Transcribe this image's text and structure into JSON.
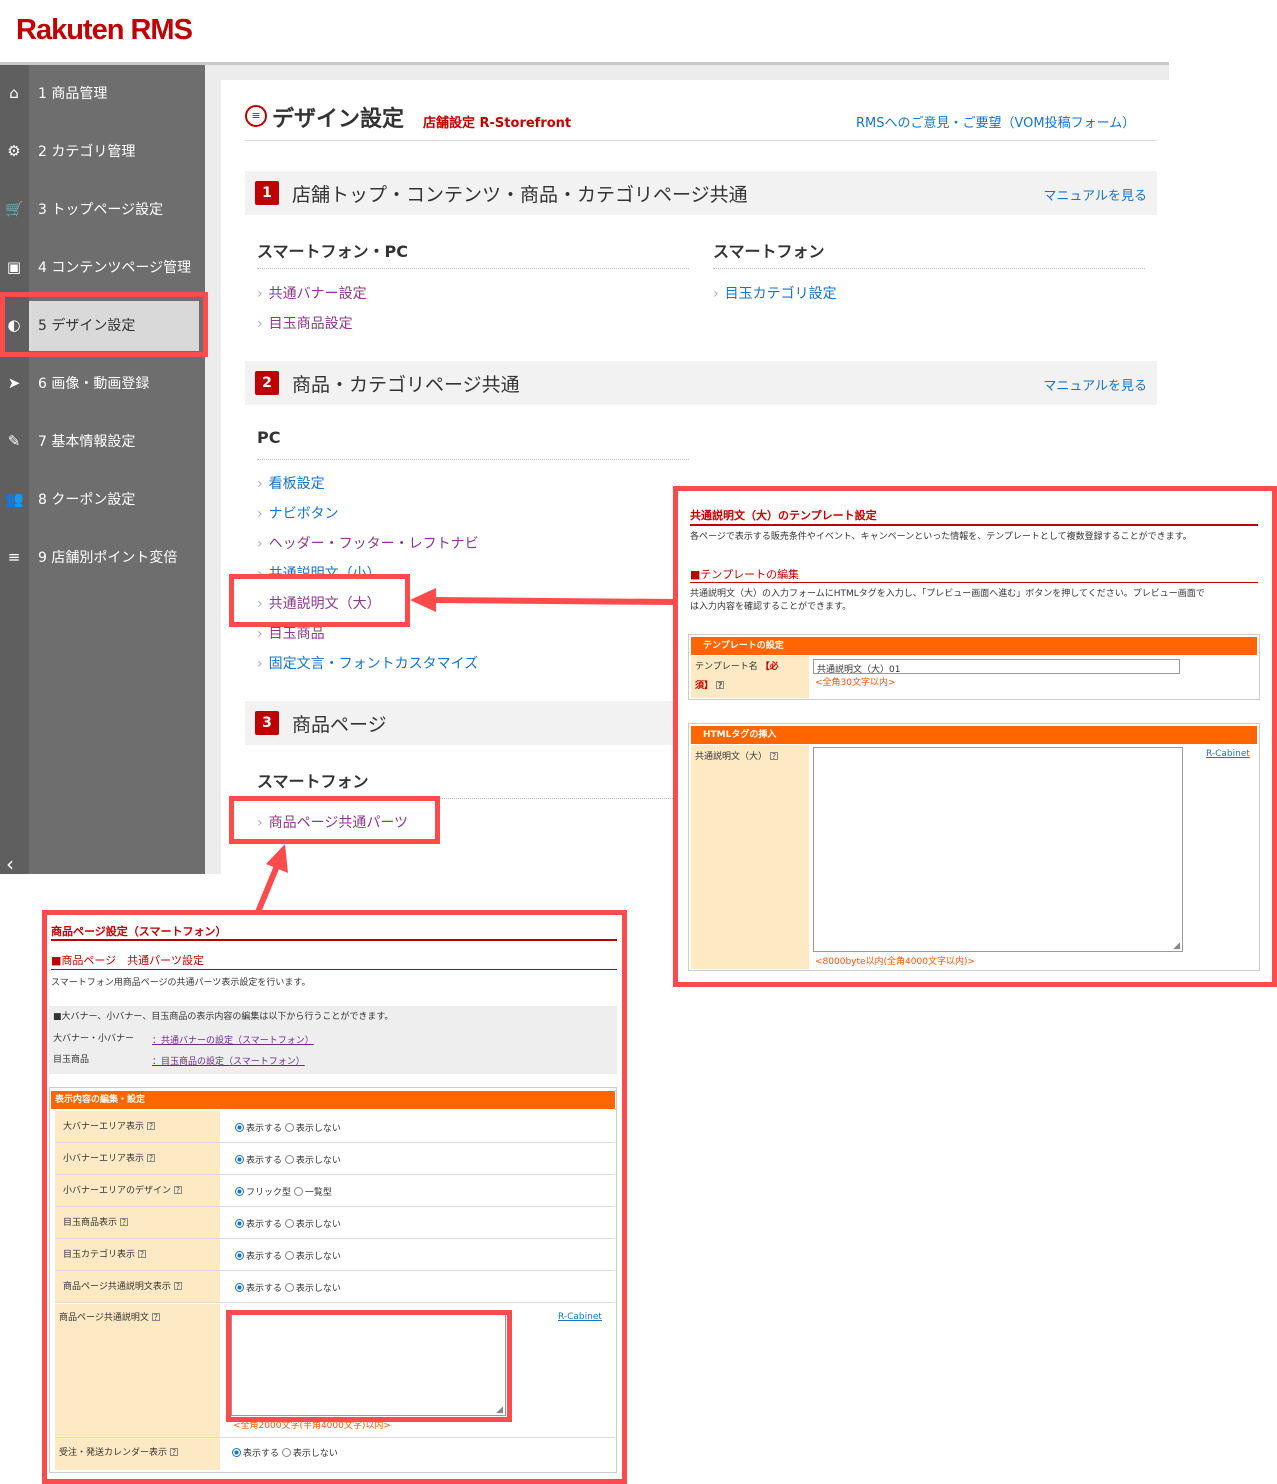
{
  "app": {
    "logo": "Rakuten RMS"
  },
  "sidebar": {
    "items": [
      {
        "label": "1 商品管理",
        "icon": "home-icon",
        "glyph": "⌂"
      },
      {
        "label": "2 カテゴリ管理",
        "icon": "gear-icon",
        "glyph": "⚙"
      },
      {
        "label": "3 トップページ設定",
        "icon": "cart-icon",
        "glyph": "🛒"
      },
      {
        "label": "4 コンテンツページ管理",
        "icon": "pages-icon",
        "glyph": "▣"
      },
      {
        "label": "5 デザイン設定",
        "icon": "paint-icon",
        "glyph": "◐"
      },
      {
        "label": "6 画像・動画登録",
        "icon": "send-icon",
        "glyph": "➤"
      },
      {
        "label": "7 基本情報設定",
        "icon": "megaphone-icon",
        "glyph": "✎"
      },
      {
        "label": "8 クーポン設定",
        "icon": "users-icon",
        "glyph": "👥"
      },
      {
        "label": "9 店舗別ポイント変倍",
        "icon": "list-icon",
        "glyph": "≡"
      }
    ],
    "collapse": "‹"
  },
  "header": {
    "title": "デザイン設定",
    "subtitle": "店舗設定 R-Storefront",
    "feedback": "RMSへのご意見・ご要望（VOM投稿フォーム）",
    "title_icon": "list-icon"
  },
  "sections": [
    {
      "num": "1",
      "title": "店舗トップ・コンテンツ・商品・カテゴリページ共通",
      "manual": "マニュアルを見る"
    },
    {
      "num": "2",
      "title": "商品・カテゴリページ共通",
      "manual": "マニュアルを見る"
    },
    {
      "num": "3",
      "title": "商品ページ"
    }
  ],
  "s1": {
    "col1": "スマートフォン・PC",
    "col2": "スマートフォン",
    "links1": [
      "共通バナー設定",
      "目玉商品設定"
    ],
    "links2": [
      "目玉カテゴリ設定"
    ]
  },
  "s2": {
    "col1": "PC",
    "links": [
      "看板設定",
      "ナビボタン",
      "ヘッダー・フッター・レフトナビ",
      "共通説明文（小）",
      "共通説明文（大）",
      "目玉商品",
      "固定文言・フォントカスタマイズ"
    ]
  },
  "s3": {
    "col1": "スマートフォン",
    "links": [
      "商品ページ共通パーツ"
    ]
  },
  "panel_right": {
    "title": "共通説明文（大）のテンプレート設定",
    "desc": "各ページで表示する販売条件やイベント、キャンペーンといった情報を、テンプレートとして複数登録することができます。",
    "edit_title": "■テンプレートの編集",
    "edit_desc1": "共通説明文（大）の入力フォームにHTMLタグを入力し、「プレビュー画面へ進む」ボタンを押してください。プレビュー画面で",
    "edit_desc2": "は入力内容を確認することができます。",
    "bar1": "テンプレートの設定",
    "name_label": "テンプレート名",
    "required": "【必",
    "required2": "須】",
    "name_value": "共通説明文（大）01",
    "name_limit": "<全角30文字以内>",
    "bar2": "HTMLタグの挿入",
    "html_label": "共通説明文（大）",
    "cabinet": "R-Cabinet",
    "html_limit": "<8000byte以内(全角4000文字以内)>"
  },
  "panel_left": {
    "title": "商品ページ設定（スマートフォン）",
    "subtitle": "■商品ページ　共通パーツ設定",
    "desc": "スマートフォン用商品ページの共通パーツ表示設定を行います。",
    "note": "■大バナー、小バナー、目玉商品の表示内容の編集は以下から行うことができます。",
    "link_rows": [
      {
        "label": "大バナー・小バナー",
        "link": "：共通バナーの設定（スマートフォン）"
      },
      {
        "label": "目玉商品",
        "link": "：目玉商品の設定（スマートフォン）"
      }
    ],
    "bar": "表示内容の編集・設定",
    "rows": [
      {
        "label": "大バナーエリア表示",
        "opt1": "表示する",
        "opt2": "表示しない"
      },
      {
        "label": "小バナーエリア表示",
        "opt1": "表示する",
        "opt2": "表示しない"
      },
      {
        "label": "小バナーエリアのデザイン",
        "opt1": "フリック型",
        "opt2": "一覧型"
      },
      {
        "label": "目玉商品表示",
        "opt1": "表示する",
        "opt2": "表示しない"
      },
      {
        "label": "目玉カテゴリ表示",
        "opt1": "表示する",
        "opt2": "表示しない"
      },
      {
        "label": "商品ページ共通説明文表示",
        "opt1": "表示する",
        "opt2": "表示しない"
      }
    ],
    "desc_label": "商品ページ共通説明文",
    "cabinet": "R-Cabinet",
    "desc_limit": "<全角2000文字(半角4000文字)以内>",
    "calendar": {
      "label": "受注・発送カレンダー表示",
      "opt1": "表示する",
      "opt2": "表示しない"
    }
  },
  "colors": {
    "brand": "#bf0000",
    "link": "#1a73c7",
    "highlight": "#ff4b4b",
    "orange": "#ff6600"
  }
}
